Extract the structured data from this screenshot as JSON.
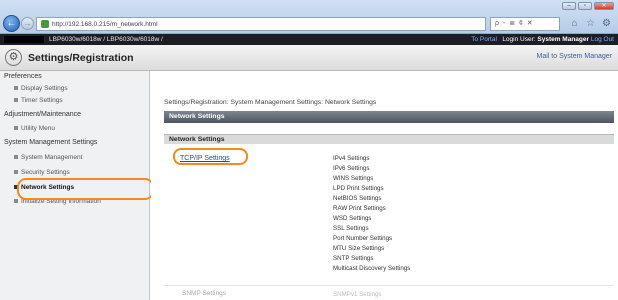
{
  "browser": {
    "url": "http://192.168.0.215/m_network.html",
    "addr_tools": "ρ - ≣ ¢ ✕",
    "back_glyph": "←",
    "forward_glyph": "→",
    "window_buttons": [
      "–",
      "▫",
      "✕"
    ],
    "toolbar_icons": [
      "home-icon",
      "star-icon",
      "gear-icon"
    ]
  },
  "topbar": {
    "path": "LBP6030w/6018w / LBP6030w/6018w /",
    "to_portal": "To Portal",
    "login_user_label": "Login User:",
    "login_user_value": "System Manager",
    "log_out": "Log Out"
  },
  "header": {
    "title": "Settings/Registration",
    "mail": "Mail to System Manager"
  },
  "sidebar": {
    "sections": [
      {
        "heading": "Preferences",
        "items": [
          "Display Settings",
          "Timer Settings"
        ]
      },
      {
        "heading": "Adjustment/Maintenance",
        "items": [
          "Utility Menu"
        ]
      },
      {
        "heading": "System Management Settings",
        "items": [
          "System Management",
          "Security Settings",
          "Network Settings",
          "Initialize Setting Information"
        ]
      }
    ],
    "selected": "Network Settings"
  },
  "main": {
    "breadcrumb": "Settings/Registration: System Management Settings: Network Settings",
    "bar_title": "Network Settings",
    "section_title": "Network Settings",
    "tcpip_link": "TCP/IP Settings",
    "tcpip_subitems": [
      "IPv4 Settings",
      "IPv6 Settings",
      "WINS Settings",
      "LPD Print Settings",
      "NetBIOS Settings",
      "RAW Print Settings",
      "WSD Settings",
      "SSL Settings",
      "Port Number Settings",
      "MTU Size Settings",
      "SNTP Settings",
      "Multicast Discovery Settings"
    ],
    "snmp_label": "SNMP Settings",
    "snmp_sub": "SNMPv1 Settings"
  },
  "colors": {
    "highlight": "#f28a1f",
    "link": "#1f4ea0"
  }
}
